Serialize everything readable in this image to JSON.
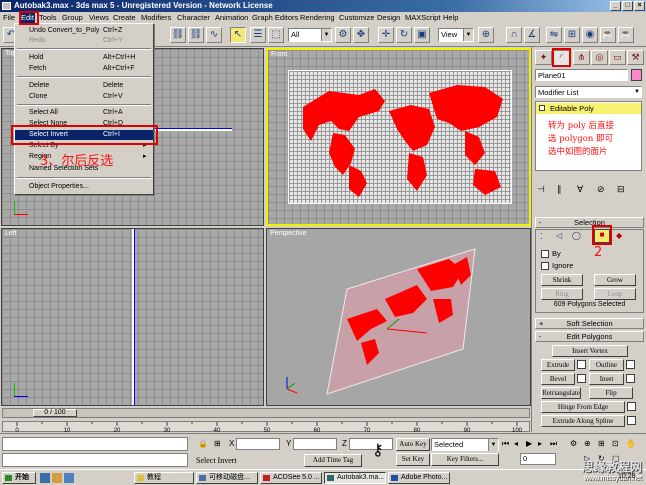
{
  "window": {
    "title": "Autobak3.max - 3ds max 5 - Unregistered Version - Network License"
  },
  "menubar": [
    "File",
    "Edit",
    "Tools",
    "Group",
    "Views",
    "Create",
    "Modifiers",
    "Character",
    "Animation",
    "Graph Editors",
    "Rendering",
    "Customize",
    "Design",
    "MAXScript",
    "Help"
  ],
  "toolbar": {
    "selection_filter": "All",
    "ref_coord": "View"
  },
  "edit_menu": {
    "items": [
      {
        "label": "Undo Convert_to_Poly",
        "shortcut": "Ctrl+Z",
        "disabled": false
      },
      {
        "label": "Redo",
        "shortcut": "Ctrl+Y",
        "disabled": true
      },
      {
        "label": "Hold",
        "shortcut": "Alt+Ctrl+H",
        "disabled": false
      },
      {
        "label": "Fetch",
        "shortcut": "Alt+Ctrl+F",
        "disabled": false
      },
      {
        "label": "Delete",
        "shortcut": "Delete",
        "disabled": false
      },
      {
        "label": "Clone",
        "shortcut": "Ctrl+V",
        "disabled": false
      },
      {
        "label": "Select All",
        "shortcut": "Ctrl+A",
        "disabled": false
      },
      {
        "label": "Select None",
        "shortcut": "Ctrl+D",
        "disabled": false
      },
      {
        "label": "Select Invert",
        "shortcut": "Ctrl+I",
        "disabled": false,
        "highlighted": true
      },
      {
        "label": "Select By",
        "shortcut": "",
        "disabled": false
      },
      {
        "label": "Region",
        "shortcut": "",
        "disabled": false
      },
      {
        "label": "Named Selection Sets",
        "shortcut": "",
        "disabled": false
      },
      {
        "label": "Object Properties...",
        "shortcut": "",
        "disabled": false
      }
    ]
  },
  "viewports": {
    "top": "Top",
    "front": "Front",
    "left": "Left",
    "perspective": "Perspective"
  },
  "annotations": {
    "step3": "3、尔后反选",
    "note_line1": "转为 poly 后直接",
    "note_line2": "选 polygon 即可",
    "note_line3": "选中如图的面片",
    "step2": "2"
  },
  "command_panel": {
    "object_name": "Plane01",
    "modifier_list": "Modifier List",
    "stack_item": "Editable Poly",
    "selection": {
      "title": "Selection",
      "by_label": "By",
      "ignore_label": "Ignore",
      "shrink": "Shrink",
      "grow": "Grow",
      "ring": "Ring",
      "loop": "Loop",
      "status": "609 Polygons Selected"
    },
    "soft_selection_title": "Soft Selection",
    "edit_polygons": {
      "title": "Edit Polygons",
      "insert_vertex": "Insert Vertex",
      "extrude": "Extrude",
      "outline": "Outline",
      "bevel": "Bevel",
      "inset": "Inset",
      "retriangulate": "Retriangulate",
      "flip": "Flip",
      "hinge": "Hinge From Edge",
      "extrude_spline": "Extrude Along Spline"
    }
  },
  "timeline": {
    "frame": "0 / 100",
    "ticks": [
      "0",
      "10",
      "20",
      "30",
      "40",
      "50",
      "60",
      "70",
      "80",
      "90",
      "100"
    ]
  },
  "status": {
    "prompt": "Select Invert",
    "x_label": "X",
    "y_label": "Y",
    "z_label": "Z",
    "add_time_tag": "Add Time Tag",
    "auto_key": "Auto Key",
    "set_key": "Set Key",
    "key_mode": "Selected",
    "key_filters": "Key Filters...",
    "frame_value": "0"
  },
  "taskbar": {
    "start": "开始",
    "tasks": [
      "教程",
      "可移动磁盘...",
      "ACDSee 5.0 ...",
      "Autobak3.ma...",
      "Adobe Photo..."
    ],
    "clock": "10:28",
    "watermark_line1": "思缘教程网",
    "watermark_line2": "www.missyuan.net"
  }
}
